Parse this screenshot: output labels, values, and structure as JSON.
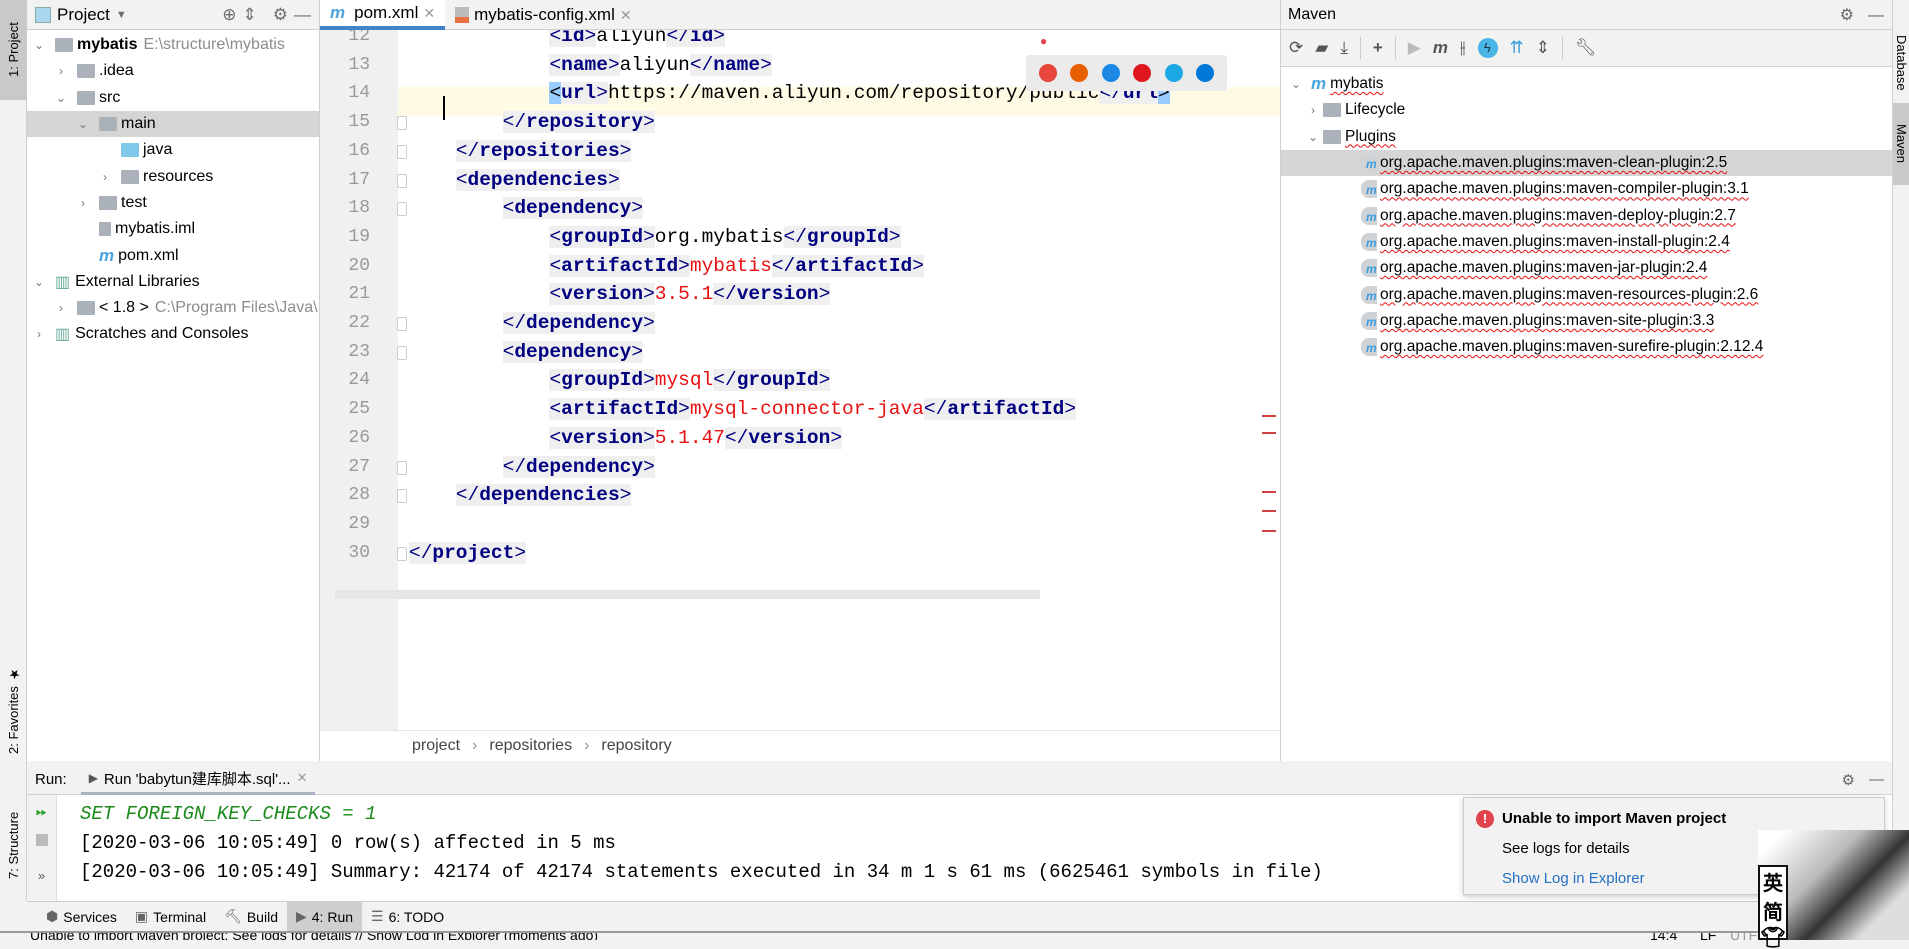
{
  "left_stripe": {
    "project": "1: Project",
    "favorites": "2: Favorites",
    "structure": "7: Structure"
  },
  "right_stripe": {
    "database": "Database",
    "maven": "Maven"
  },
  "project_panel": {
    "title": "Project",
    "items": [
      {
        "label": "mybatis",
        "hint": "E:\\structure\\mybatis",
        "depth": 0,
        "arrow": "down",
        "bold": true
      },
      {
        "label": ".idea",
        "depth": 1,
        "arrow": "right"
      },
      {
        "label": "src",
        "depth": 1,
        "arrow": "down"
      },
      {
        "label": "main",
        "depth": 2,
        "arrow": "down",
        "selected": true
      },
      {
        "label": "java",
        "depth": 3,
        "arrow": "",
        "blue": true
      },
      {
        "label": "resources",
        "depth": 3,
        "arrow": "right"
      },
      {
        "label": "test",
        "depth": 2,
        "arrow": "right"
      },
      {
        "label": "mybatis.iml",
        "depth": 2,
        "arrow": "",
        "file": true
      },
      {
        "label": "pom.xml",
        "depth": 2,
        "arrow": "",
        "maven": true
      },
      {
        "label": "External Libraries",
        "depth": 0,
        "arrow": "down",
        "lib": true
      },
      {
        "label": "< 1.8 >",
        "hint": "C:\\Program Files\\Java\\",
        "depth": 1,
        "arrow": "right"
      },
      {
        "label": "Scratches and Consoles",
        "depth": 0,
        "arrow": "right",
        "lib": true
      }
    ]
  },
  "editor": {
    "tabs": [
      {
        "label": "pom.xml",
        "active": true
      },
      {
        "label": "mybatis-config.xml",
        "active": false
      }
    ],
    "current_line": 14,
    "lines": [
      {
        "n": "12",
        "indent": 12,
        "tokens": [
          [
            "tb",
            "<"
          ],
          [
            "t",
            "id"
          ],
          [
            "tb",
            ">"
          ],
          [
            "tx",
            "aliyun"
          ],
          [
            "tb",
            "</"
          ],
          [
            "t",
            "id"
          ],
          [
            "tb",
            ">"
          ]
        ]
      },
      {
        "n": "13",
        "indent": 12,
        "tokens": [
          [
            "tb",
            "<"
          ],
          [
            "t",
            "name"
          ],
          [
            "tb",
            ">"
          ],
          [
            "tx",
            "aliyun"
          ],
          [
            "tb",
            "</"
          ],
          [
            "t",
            "name"
          ],
          [
            "tb",
            ">"
          ]
        ]
      },
      {
        "n": "14",
        "indent": 12,
        "tokens": [
          [
            "hl",
            "<"
          ],
          [
            "t",
            "url"
          ],
          [
            "tb",
            ">"
          ],
          [
            "tx",
            "https://maven.aliyun.com/repository/public"
          ],
          [
            "tb",
            "</"
          ],
          [
            "t",
            "url"
          ],
          [
            "hl",
            ">"
          ]
        ]
      },
      {
        "n": "15",
        "indent": 8,
        "tokens": [
          [
            "tb",
            "</"
          ],
          [
            "t",
            "repository"
          ],
          [
            "tb",
            ">"
          ]
        ]
      },
      {
        "n": "16",
        "indent": 4,
        "tokens": [
          [
            "tb",
            "</"
          ],
          [
            "t",
            "repositories"
          ],
          [
            "tb",
            ">"
          ]
        ]
      },
      {
        "n": "17",
        "indent": 4,
        "tokens": [
          [
            "tb",
            "<"
          ],
          [
            "t",
            "dependencies"
          ],
          [
            "tb",
            ">"
          ]
        ]
      },
      {
        "n": "18",
        "indent": 8,
        "tokens": [
          [
            "tb",
            "<"
          ],
          [
            "t",
            "dependency"
          ],
          [
            "tb",
            ">"
          ]
        ]
      },
      {
        "n": "19",
        "indent": 12,
        "tokens": [
          [
            "tb",
            "<"
          ],
          [
            "t",
            "groupId"
          ],
          [
            "tb",
            ">"
          ],
          [
            "tx",
            "org.mybatis"
          ],
          [
            "tb",
            "</"
          ],
          [
            "t",
            "groupId"
          ],
          [
            "tb",
            ">"
          ]
        ]
      },
      {
        "n": "20",
        "indent": 12,
        "tokens": [
          [
            "tb",
            "<"
          ],
          [
            "t",
            "artifactId"
          ],
          [
            "tb",
            ">"
          ],
          [
            "v",
            "mybatis"
          ],
          [
            "tb",
            "</"
          ],
          [
            "t",
            "artifactId"
          ],
          [
            "tb",
            ">"
          ]
        ]
      },
      {
        "n": "21",
        "indent": 12,
        "tokens": [
          [
            "tb",
            "<"
          ],
          [
            "t",
            "version"
          ],
          [
            "tb",
            ">"
          ],
          [
            "v",
            "3.5.1"
          ],
          [
            "tb",
            "</"
          ],
          [
            "t",
            "version"
          ],
          [
            "tb",
            ">"
          ]
        ]
      },
      {
        "n": "22",
        "indent": 8,
        "tokens": [
          [
            "tb",
            "</"
          ],
          [
            "t",
            "dependency"
          ],
          [
            "tb",
            ">"
          ]
        ]
      },
      {
        "n": "23",
        "indent": 8,
        "tokens": [
          [
            "tb",
            "<"
          ],
          [
            "t",
            "dependency"
          ],
          [
            "tb",
            ">"
          ]
        ]
      },
      {
        "n": "24",
        "indent": 12,
        "tokens": [
          [
            "tb",
            "<"
          ],
          [
            "t",
            "groupId"
          ],
          [
            "tb",
            ">"
          ],
          [
            "v",
            "mysql"
          ],
          [
            "tb",
            "</"
          ],
          [
            "t",
            "groupId"
          ],
          [
            "tb",
            ">"
          ]
        ]
      },
      {
        "n": "25",
        "indent": 12,
        "tokens": [
          [
            "tb",
            "<"
          ],
          [
            "t",
            "artifactId"
          ],
          [
            "tb",
            ">"
          ],
          [
            "v",
            "mysql-connector-java"
          ],
          [
            "tb",
            "</"
          ],
          [
            "t",
            "artifactId"
          ],
          [
            "tb",
            ">"
          ]
        ]
      },
      {
        "n": "26",
        "indent": 12,
        "tokens": [
          [
            "tb",
            "<"
          ],
          [
            "t",
            "version"
          ],
          [
            "tb",
            ">"
          ],
          [
            "v",
            "5.1.47"
          ],
          [
            "tb",
            "</"
          ],
          [
            "t",
            "version"
          ],
          [
            "tb",
            ">"
          ]
        ]
      },
      {
        "n": "27",
        "indent": 8,
        "tokens": [
          [
            "tb",
            "</"
          ],
          [
            "t",
            "dependency"
          ],
          [
            "tb",
            ">"
          ]
        ]
      },
      {
        "n": "28",
        "indent": 4,
        "tokens": [
          [
            "tb",
            "</"
          ],
          [
            "t",
            "dependencies"
          ],
          [
            "tb",
            ">"
          ]
        ]
      },
      {
        "n": "29",
        "indent": 0,
        "tokens": []
      },
      {
        "n": "30",
        "indent": 0,
        "tokens": [
          [
            "tb",
            "</"
          ],
          [
            "t",
            "project"
          ],
          [
            "tb",
            ">"
          ]
        ]
      }
    ],
    "breadcrumb": [
      "project",
      "repositories",
      "repository"
    ],
    "browser_icons": [
      "chrome",
      "firefox",
      "safari",
      "opera",
      "ie",
      "edge"
    ],
    "browser_colors": [
      "#e8453c",
      "#e66000",
      "#1e88e5",
      "#e0161e",
      "#1ea7e5",
      "#0078d7"
    ]
  },
  "maven_panel": {
    "title": "Maven",
    "toolbar_icons": [
      "reload-icon",
      "generate-sources-icon",
      "download-icon",
      "add-icon",
      "run-icon",
      "execute-goal-icon",
      "toggle-offline-icon",
      "skip-tests-icon",
      "show-dependencies-icon",
      "collapse-all-icon",
      "settings-wrench-icon"
    ],
    "root": "mybatis",
    "lifecycle": "Lifecycle",
    "plugins_label": "Plugins",
    "plugins": [
      "org.apache.maven.plugins:maven-clean-plugin:2.5",
      "org.apache.maven.plugins:maven-compiler-plugin:3.1",
      "org.apache.maven.plugins:maven-deploy-plugin:2.7",
      "org.apache.maven.plugins:maven-install-plugin:2.4",
      "org.apache.maven.plugins:maven-jar-plugin:2.4",
      "org.apache.maven.plugins:maven-resources-plugin:2.6",
      "org.apache.maven.plugins:maven-site-plugin:3.3",
      "org.apache.maven.plugins:maven-surefire-plugin:2.12.4"
    ]
  },
  "run_panel": {
    "label": "Run:",
    "tab": "Run 'babytun建库脚本.sql'...",
    "lines": [
      "SET FOREIGN_KEY_CHECKS = 1",
      "[2020-03-06 10:05:49] 0 row(s) affected in 5 ms",
      "[2020-03-06 10:05:49] Summary: 42174 of 42174 statements executed in 34 m 1 s 61 ms (6625461 symbols in file)"
    ]
  },
  "notification": {
    "title": "Unable to import Maven project",
    "body": "See logs for details",
    "link": "Show Log in Explorer"
  },
  "toolwindows": [
    {
      "label": "Services"
    },
    {
      "label": "Terminal"
    },
    {
      "label": "Build"
    },
    {
      "label": "4: Run",
      "selected": true
    },
    {
      "label": "6: TODO"
    }
  ],
  "status_bar": {
    "message": "Unable to import Maven project: See logs for details // Show Log in Explorer (moments ago)",
    "position": "14:4",
    "line_sep": "LF",
    "encoding": "UTF"
  },
  "ime": {
    "chars": [
      "英",
      "简"
    ]
  },
  "colors": {
    "tag": "#000080",
    "value": "#e81010",
    "accent": "#4083c9",
    "console_green": "#1a8a1a",
    "link": "#2470c4",
    "error": "#e0434b"
  }
}
